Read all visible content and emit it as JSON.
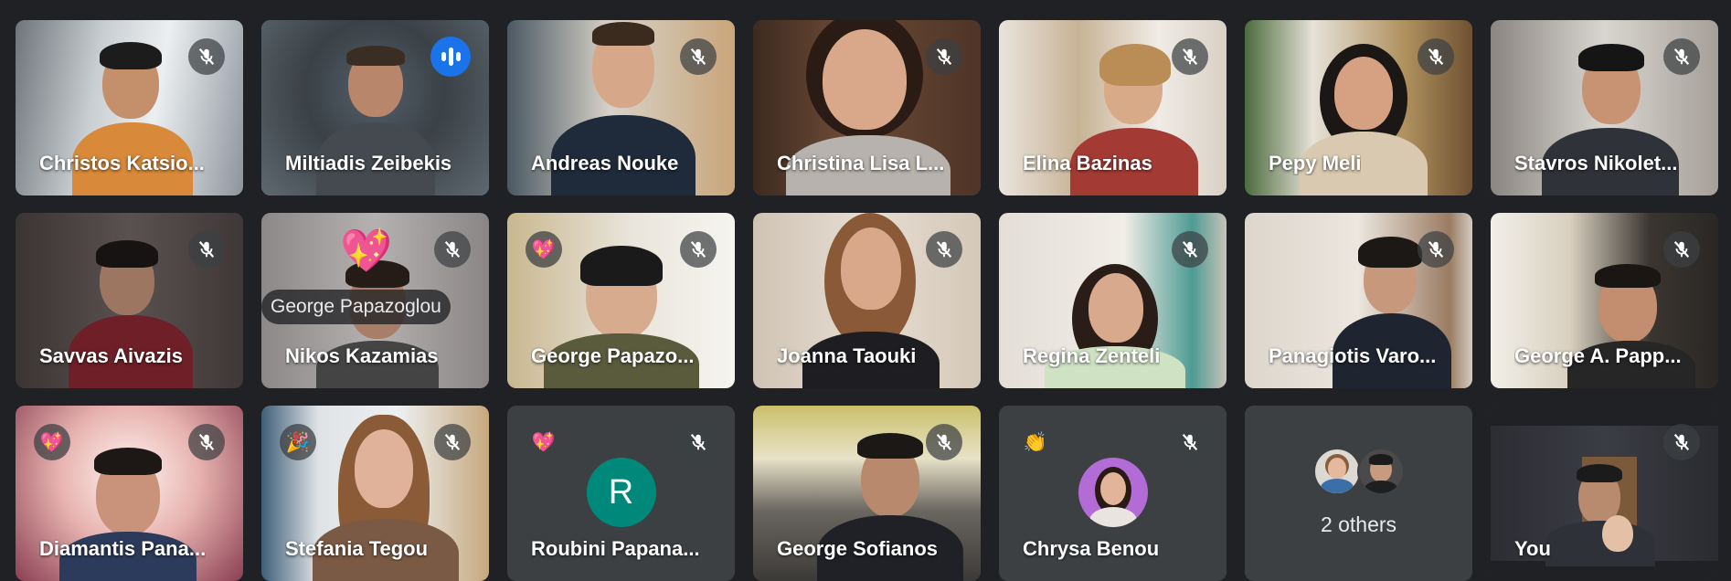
{
  "participants": [
    {
      "name": "Christos Katsio...",
      "muted": true
    },
    {
      "name": "Miltiadis Zeibekis",
      "speaking": true
    },
    {
      "name": "Andreas Nouke",
      "muted": true
    },
    {
      "name": "Christina Lisa L...",
      "muted": true
    },
    {
      "name": "Elina Bazinas",
      "muted": true
    },
    {
      "name": "Pepy Meli",
      "muted": true
    },
    {
      "name": "Stavros Nikolet...",
      "muted": true
    },
    {
      "name": "Savvas Aivazis",
      "muted": true
    },
    {
      "name": "Nikos Kazamias",
      "muted": true,
      "reaction": "💖",
      "floating_name": "George Papazoglou"
    },
    {
      "name": "George Papazo...",
      "muted": true,
      "reaction": "💖"
    },
    {
      "name": "Joanna Taouki",
      "muted": true
    },
    {
      "name": "Regina Zenteli",
      "muted": true
    },
    {
      "name": "Panagiotis Varo...",
      "muted": true
    },
    {
      "name": "George A. Papp...",
      "muted": true
    },
    {
      "name": "Diamantis Pana...",
      "muted": true,
      "reaction": "💖"
    },
    {
      "name": "Stefania Tegou",
      "muted": true,
      "reaction": "🎉"
    },
    {
      "name": "Roubini Papana...",
      "muted": true,
      "reaction": "💖",
      "avatar_letter": "R",
      "avatar_color": "#00897b"
    },
    {
      "name": "George Sofianos",
      "muted": true
    },
    {
      "name": "Chrysa Benou",
      "muted": true,
      "reaction": "👏"
    },
    {
      "others_label": "2 others"
    },
    {
      "name": "You",
      "muted": true
    }
  ],
  "colors": {
    "background": "#202124",
    "tile": "#3c4043",
    "active_border": "#8ab4f8",
    "speaking": "#1a73e8"
  }
}
